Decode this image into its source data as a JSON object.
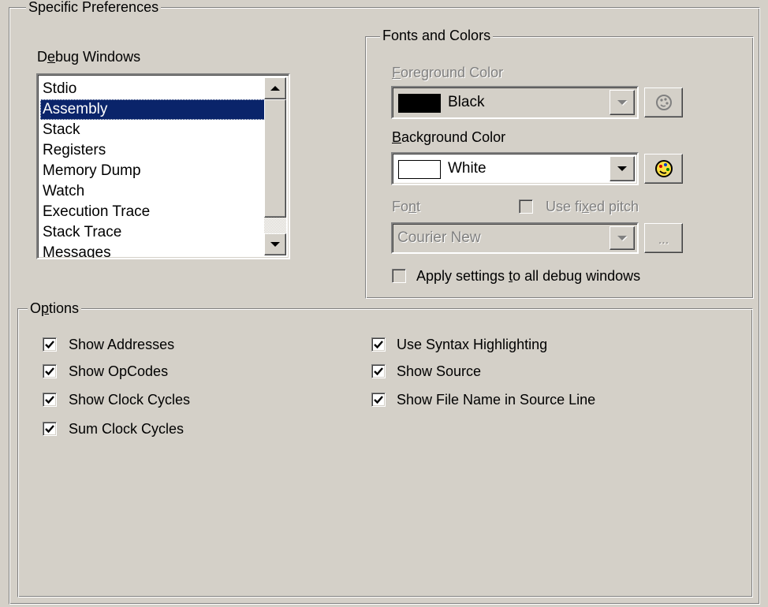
{
  "specific_preferences": {
    "title": "Specific Preferences",
    "debug_windows": {
      "label_pre": "D",
      "label_accel": "e",
      "label_post": "bug Windows",
      "items": [
        "Stdio",
        "Assembly",
        "Stack",
        "Registers",
        "Memory Dump",
        "Watch",
        "Execution Trace",
        "Stack Trace",
        "Messages"
      ],
      "selected_index": 1
    }
  },
  "fonts_and_colors": {
    "title": "Fonts and Colors",
    "foreground": {
      "label_accel": "F",
      "label_post": "oreground Color",
      "value": "Black",
      "swatch_color": "#000000",
      "enabled": false
    },
    "background": {
      "label_accel": "B",
      "label_post": "ackground Color",
      "value": "White",
      "swatch_color": "#ffffff",
      "enabled": true
    },
    "font": {
      "label_pre": "Fo",
      "label_accel": "n",
      "label_post": "t",
      "value": "Courier New",
      "browse_label": "...",
      "enabled": false
    },
    "fixed_pitch": {
      "label_pre": "Use fi",
      "label_accel": "x",
      "label_post": "ed pitch",
      "checked": false,
      "enabled": false
    },
    "apply_all": {
      "label_pre": "Apply settings ",
      "label_accel": "t",
      "label_post": "o all debug windows",
      "checked": false
    }
  },
  "options": {
    "title_pre": "O",
    "title_accel": "p",
    "title_post": "tions",
    "left": [
      {
        "label": "Show Addresses",
        "checked": true
      },
      {
        "label": "Show OpCodes",
        "checked": true
      },
      {
        "label": "Show Clock Cycles",
        "checked": true
      },
      {
        "label": "Sum Clock Cycles",
        "checked": true
      }
    ],
    "right": [
      {
        "label": "Use Syntax Highlighting",
        "checked": true
      },
      {
        "label": "Show Source",
        "checked": true
      },
      {
        "label": "Show File Name in Source Line",
        "checked": true
      }
    ]
  },
  "colors": {
    "dialog_bg": "#d4d0c8",
    "selection_bg": "#0a246a",
    "disabled_text": "#808080"
  },
  "icons": {
    "color_picker": "palette-icon",
    "dropdown": "chevron-down-icon",
    "checkmark": "checkmark-icon"
  }
}
